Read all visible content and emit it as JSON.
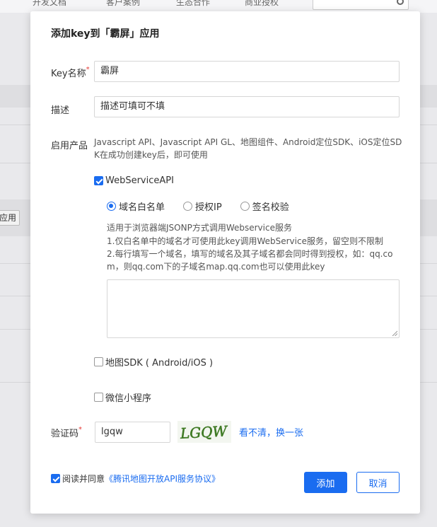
{
  "background": {
    "nav": [
      "开发文档",
      "客户案例",
      "生态合作",
      "商业授权"
    ],
    "apply_label": "应用"
  },
  "modal": {
    "title": "添加key到「霸屏」应用",
    "key_name": {
      "label": "Key名称",
      "value": "霸屏"
    },
    "description": {
      "label": "描述",
      "value": "描述可填可不填"
    },
    "products": {
      "label": "启用产品",
      "text": "Javascript API、Javascript API GL、地图组件、Android定位SDK、iOS定位SDK在成功创建key后，即可使用"
    },
    "webservice": {
      "label": "WebServiceAPI",
      "checked": true,
      "options": [
        {
          "label": "域名白名单",
          "selected": true
        },
        {
          "label": "授权IP",
          "selected": false
        },
        {
          "label": "签名校验",
          "selected": false
        }
      ],
      "help": [
        "适用于浏览器端JSONP方式调用Webservice服务",
        "1.仅白名单中的域名才可使用此key调用WebService服务，留空则不限制",
        "2.每行填写一个域名，填写的域名及其子域名都会同时得到授权，如：qq.com，则qq.com下的子域名map.qq.com也可以使用此key"
      ]
    },
    "map_sdk": {
      "label": "地图SDK ( Android/iOS )",
      "checked": false
    },
    "mini_program": {
      "label": "微信小程序",
      "checked": false
    },
    "captcha": {
      "label": "验证码",
      "value": "lgqw",
      "image_text": "LGQW",
      "refresh": "看不清，换一张"
    },
    "agreement": {
      "checked": true,
      "prefix": "阅读并同意",
      "link": "《腾讯地图开放API服务协议》"
    },
    "buttons": {
      "add": "添加",
      "cancel": "取消"
    }
  },
  "colors": {
    "primary": "#1a6cf0",
    "required": "#e53935"
  }
}
